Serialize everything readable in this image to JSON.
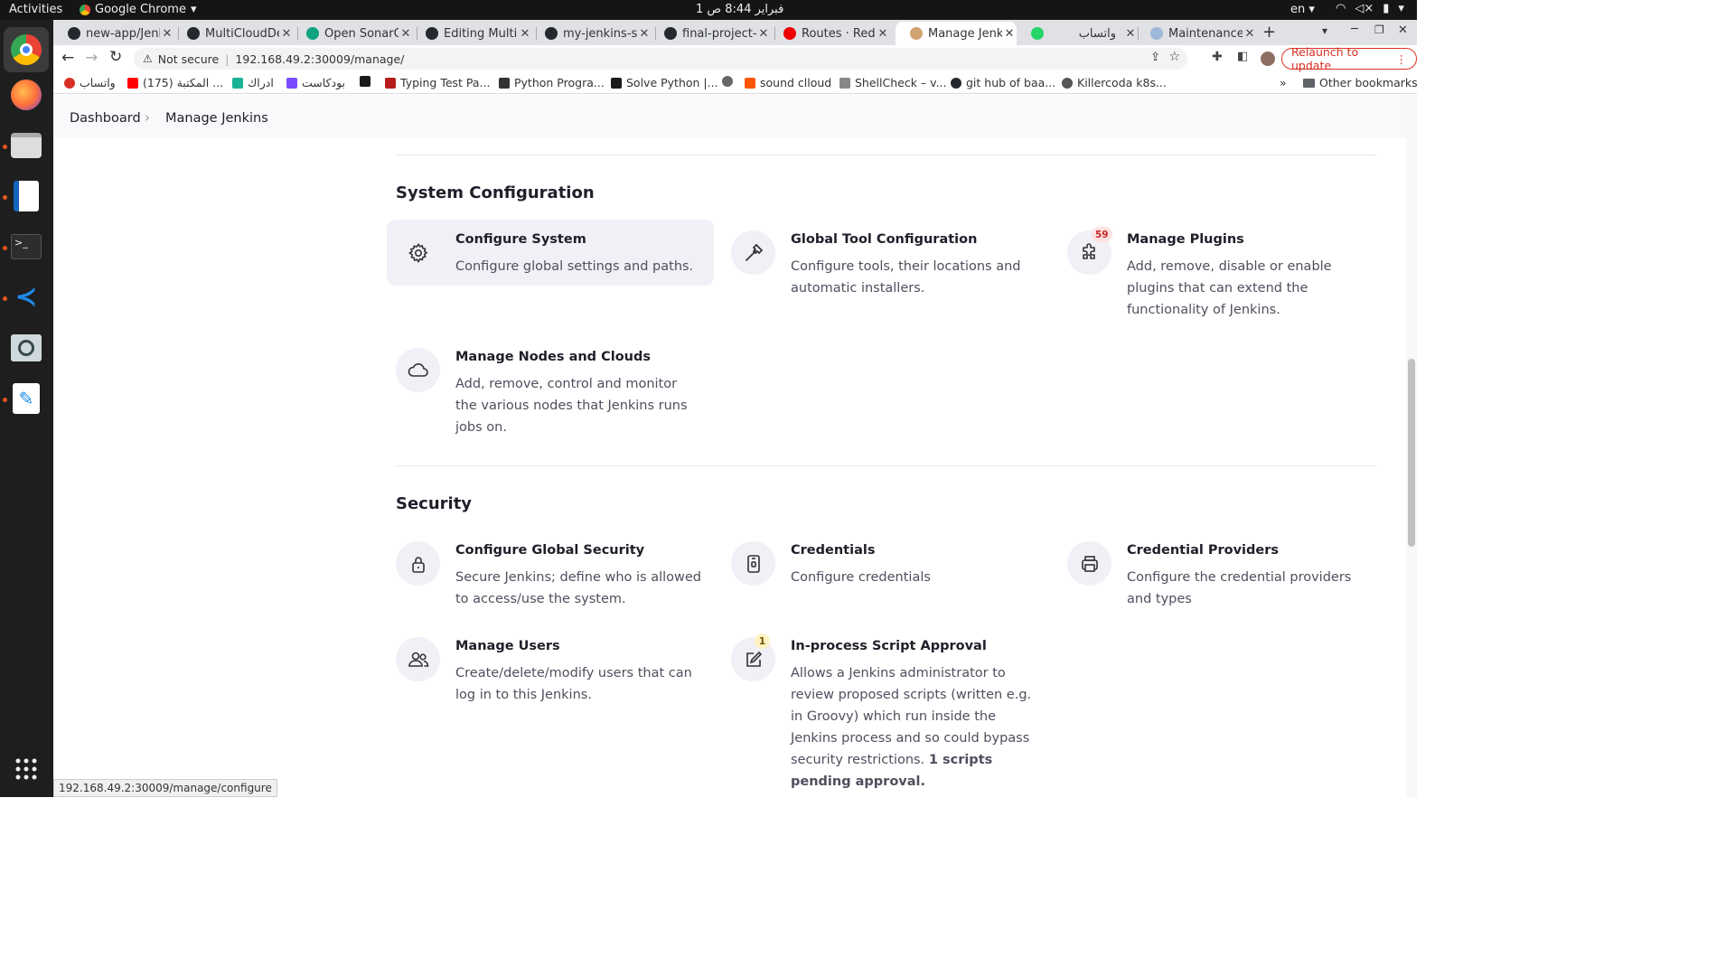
{
  "system_bar": {
    "activities": "Activities",
    "app": "Google Chrome",
    "clock": "1 فبراير  8:44 ص",
    "lang": "en"
  },
  "tabs": [
    {
      "title": "new-app/Jenk",
      "icon": "github-icon"
    },
    {
      "title": "MultiCloudDe",
      "icon": "github-icon"
    },
    {
      "title": "Open SonarQ",
      "icon": "chatgpt-icon"
    },
    {
      "title": "Editing MultiC",
      "icon": "github-icon"
    },
    {
      "title": "my-jenkins-sh",
      "icon": "github-icon"
    },
    {
      "title": "final-project-C",
      "icon": "github-icon"
    },
    {
      "title": "Routes · Red H",
      "icon": "openshift-icon"
    },
    {
      "title": "Manage Jenki",
      "icon": "jenkins-icon"
    },
    {
      "title": "واتساب",
      "icon": "whatsapp-icon"
    },
    {
      "title": "Maintenance",
      "icon": "maintenance-icon"
    }
  ],
  "omnibox": {
    "security": "Not secure",
    "url": "192.168.49.2:30009/manage/"
  },
  "relaunch": "Relaunch to update",
  "bookmarks": [
    {
      "label": "واتساب",
      "color": "#d93025"
    },
    {
      "label": "(175) المكتبة ...",
      "color": "#ff0000"
    },
    {
      "label": "ادراك",
      "color": "#1ab394"
    },
    {
      "label": "بودكاست",
      "color": "#7b4cff"
    },
    {
      "label": "",
      "color": "#1a1a1a"
    },
    {
      "label": "Typing Test Pa...",
      "color": "#b71c1c"
    },
    {
      "label": "Python Progra...",
      "color": "#333333"
    },
    {
      "label": "Solve Python |...",
      "color": "#1b1b1b"
    },
    {
      "label": "",
      "color": "#666666"
    },
    {
      "label": "sound clloud",
      "color": "#ff5500"
    },
    {
      "label": "ShellCheck – v...",
      "color": "#888888"
    },
    {
      "label": "git hub of baa...",
      "color": "#24292f"
    },
    {
      "label": "Killercoda k8s...",
      "color": "#555555"
    }
  ],
  "other_bookmarks": "Other bookmarks",
  "breadcrumb": {
    "dashboard": "Dashboard",
    "current": "Manage Jenkins"
  },
  "sections": {
    "system": {
      "title": "System Configuration",
      "items": [
        {
          "title": "Configure System",
          "desc": "Configure global settings and paths."
        },
        {
          "title": "Global Tool Configuration",
          "desc": "Configure tools, their locations and automatic installers."
        },
        {
          "title": "Manage Plugins",
          "desc": "Add, remove, disable or enable plugins that can extend the functionality of Jenkins.",
          "badge": "59"
        },
        {
          "title": "Manage Nodes and Clouds",
          "desc": "Add, remove, control and monitor the various nodes that Jenkins runs jobs on."
        }
      ]
    },
    "security": {
      "title": "Security",
      "items": [
        {
          "title": "Configure Global Security",
          "desc": "Secure Jenkins; define who is allowed to access/use the system."
        },
        {
          "title": "Credentials",
          "desc": "Configure credentials"
        },
        {
          "title": "Credential Providers",
          "desc": "Configure the credential providers and types"
        },
        {
          "title": "Manage Users",
          "desc": "Create/delete/modify users that can log in to this Jenkins."
        },
        {
          "title": "In-process Script Approval",
          "desc": "Allows a Jenkins administrator to review proposed scripts (written e.g. in Groovy) which run inside the Jenkins process and so could bypass security restrictions.",
          "desc_bold": "1 scripts pending approval.",
          "badge": "1"
        }
      ]
    }
  },
  "status_url": "192.168.49.2:30009/manage/configure",
  "colors": {
    "relaunch": "#d93025",
    "plugin_badge_bg": "#fde2e2",
    "plugin_badge_fg": "#c62828",
    "script_badge_bg": "#fff3c4",
    "script_badge_fg": "#6b5300"
  }
}
